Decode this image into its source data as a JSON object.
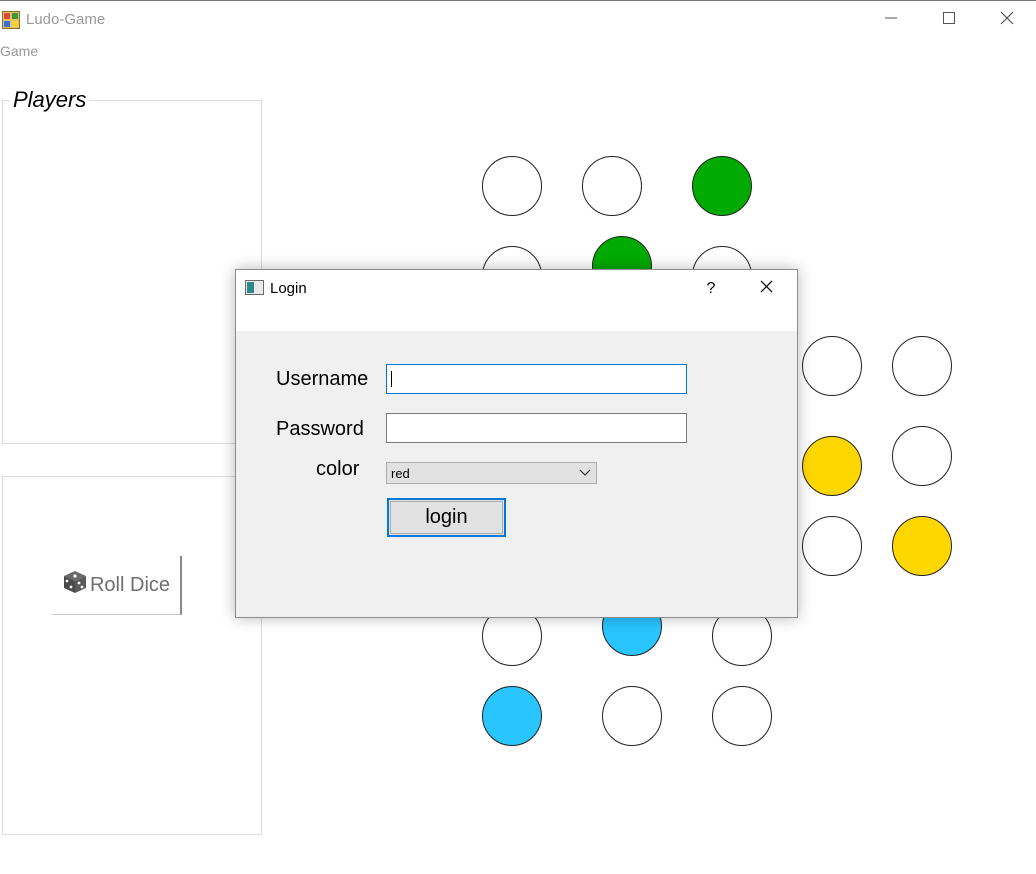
{
  "window": {
    "title": "Ludo-Game",
    "icon": "ludo-board-icon",
    "controls": [
      "minimize-icon",
      "maximize-icon",
      "close-icon"
    ]
  },
  "menu": {
    "items": [
      "Game"
    ]
  },
  "players_panel": {
    "title": "Players"
  },
  "dice_panel": {
    "roll_label": "Roll Dice",
    "icon": "dice-icon"
  },
  "board": {
    "colors": {
      "empty": "#ffffff",
      "green": "#00aa00",
      "yellow": "#ffd700",
      "blue": "#29c5ff"
    }
  },
  "login_dialog": {
    "title": "Login",
    "help": "?",
    "username_label": "Username",
    "username_value": "",
    "password_label": "Password",
    "password_value": "",
    "color_label": "color",
    "color_selected": "red",
    "login_button": "login"
  }
}
